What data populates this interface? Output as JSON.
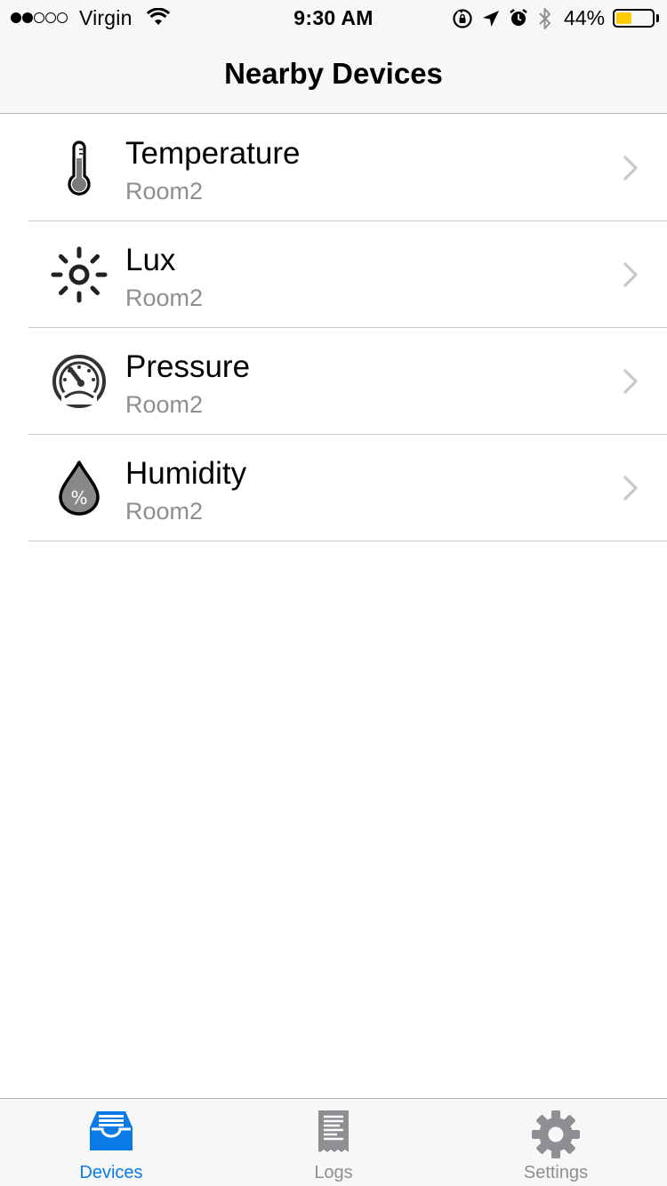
{
  "status_bar": {
    "carrier": "Virgin",
    "signal_bars_on": 2,
    "signal_bars_total": 5,
    "time": "9:30 AM",
    "battery_percent": "44%",
    "battery_level": 0.44,
    "battery_color": "#ffcc00",
    "icons": [
      "rotation-lock-icon",
      "location-icon",
      "alarm-icon",
      "bluetooth-icon"
    ]
  },
  "nav": {
    "title": "Nearby Devices"
  },
  "devices": [
    {
      "name": "Temperature",
      "location": "Room2",
      "icon": "thermometer-icon"
    },
    {
      "name": "Lux",
      "location": "Room2",
      "icon": "sun-icon"
    },
    {
      "name": "Pressure",
      "location": "Room2",
      "icon": "gauge-icon"
    },
    {
      "name": "Humidity",
      "location": "Room2",
      "icon": "humidity-drop-icon"
    }
  ],
  "tab_bar": {
    "accent_color": "#0a7ae6",
    "tabs": [
      {
        "label": "Devices",
        "icon": "inbox-tray-icon",
        "active": true
      },
      {
        "label": "Logs",
        "icon": "receipt-icon",
        "active": false
      },
      {
        "label": "Settings",
        "icon": "gear-icon",
        "active": false
      }
    ]
  }
}
